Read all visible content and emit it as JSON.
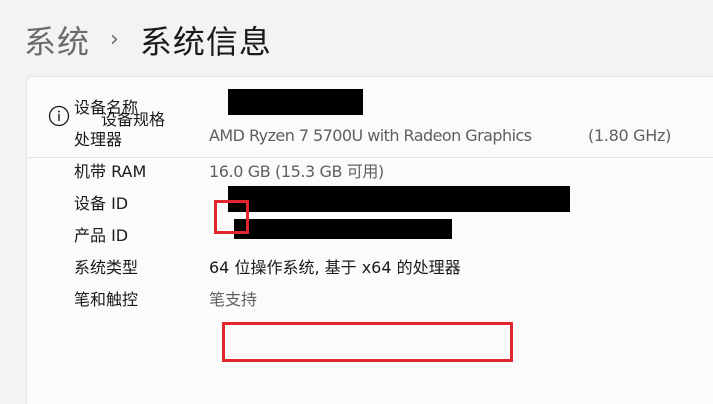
{
  "breadcrumb": {
    "parent": "系统",
    "separator": "›",
    "current": "系统信息"
  },
  "section": {
    "icon": "info-icon",
    "title": "设备规格"
  },
  "specs": [
    {
      "label": "设备名称",
      "value": "",
      "redacted": true
    },
    {
      "label": "处理器",
      "value": "AMD Ryzen 7 5700U with Radeon Graphics",
      "extra": "(1.80 GHz)"
    },
    {
      "label": "机带 RAM",
      "value": "16.0 GB (15.3 GB 可用)"
    },
    {
      "label": "设备 ID",
      "value": "",
      "redacted": true
    },
    {
      "label": "产品 ID",
      "value": "",
      "redacted": true
    },
    {
      "label": "系统类型",
      "value": "64 位操作系统, 基于 x64 的处理器"
    },
    {
      "label": "笔和触控",
      "value": "笔支持"
    }
  ],
  "highlight_color": "#e3262d",
  "colors": {
    "background": "#f3f3f3",
    "card": "#fbfbfb",
    "secondary_text": "#5f5f5f"
  }
}
